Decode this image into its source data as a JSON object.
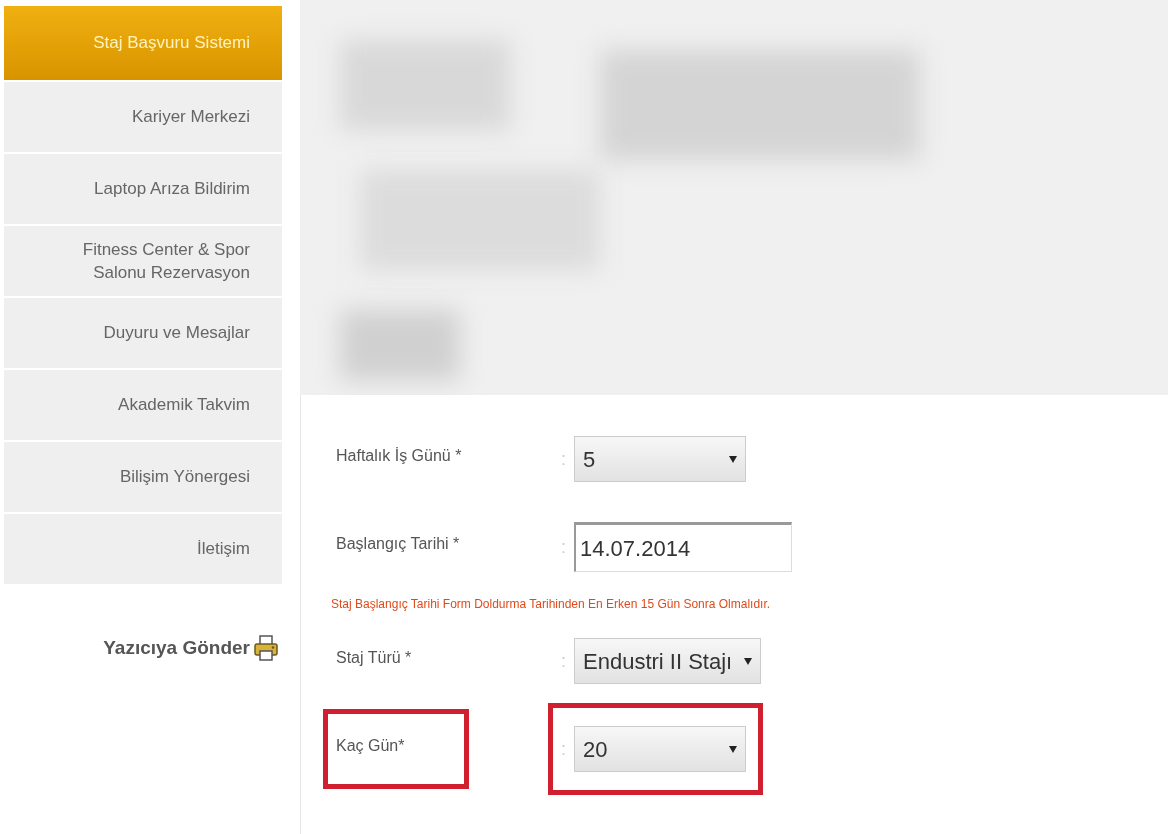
{
  "sidebar": {
    "items": [
      {
        "label": "Staj Başvuru Sistemi",
        "selected": true
      },
      {
        "label": "Kariyer Merkezi",
        "selected": false
      },
      {
        "label": "Laptop Arıza Bildirim",
        "selected": false
      },
      {
        "label": "Fitness Center & Spor Salonu Rezervasyon",
        "selected": false
      },
      {
        "label": "Duyuru ve Mesajlar",
        "selected": false
      },
      {
        "label": "Akademik Takvim",
        "selected": false
      },
      {
        "label": "Bilişim Yönergesi",
        "selected": false
      },
      {
        "label": "İletişim",
        "selected": false
      }
    ],
    "print_link": "Yazıcıya Gönder"
  },
  "form": {
    "rows": [
      {
        "kind": "select",
        "label": "Haftalık İş Günü *",
        "separator": ":",
        "value": "5",
        "highlighted": false
      },
      {
        "kind": "date",
        "label": "Başlangıç Tarihi *",
        "separator": ":",
        "value": "14.07.2014",
        "highlighted": false
      },
      {
        "kind": "note",
        "text": "Staj Başlangıç Tarihi Form Doldurma Tarihinden En Erken 15 Gün Sonra Olmalıdır."
      },
      {
        "kind": "select",
        "label": "Staj Türü *",
        "separator": ":",
        "value": "Endustri II Stajı",
        "highlighted": false
      },
      {
        "kind": "select",
        "label": "Kaç Gün*",
        "separator": ":",
        "value": "20",
        "highlighted": true
      }
    ]
  }
}
